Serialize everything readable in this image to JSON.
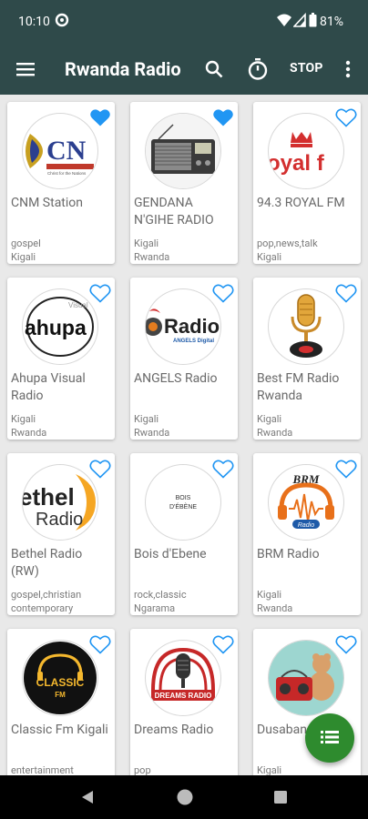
{
  "status_bar": {
    "time": "10:10",
    "battery": "81%"
  },
  "app_bar": {
    "title": "Rwanda Radio",
    "stop_label": "STOP",
    "icons": [
      "menu-icon",
      "search-icon",
      "timer-icon",
      "more-vert-icon"
    ]
  },
  "stations": [
    {
      "name": "CNM Station",
      "genre": "gospel",
      "city": "Kigali",
      "favorite": true,
      "logo_text": "CN",
      "logo_subtext": "Christ for the Nations"
    },
    {
      "name": "GENDANA N'GIHE RADIO",
      "genre": "Kigali",
      "city": "Rwanda",
      "favorite": true,
      "logo_text": "",
      "logo_subtext": ""
    },
    {
      "name": "94.3 ROYAL FM",
      "genre": "pop,news,talk",
      "city": "Kigali",
      "favorite": false,
      "logo_text": "oyal f",
      "logo_subtext": ""
    },
    {
      "name": "Ahupa Visual Radio",
      "genre": "Kigali",
      "city": "Rwanda",
      "favorite": false,
      "logo_text": "ahupa",
      "logo_subtext": "Visual"
    },
    {
      "name": "ANGELS Radio",
      "genre": "Kigali",
      "city": "Rwanda",
      "favorite": false,
      "logo_text": "Radio",
      "logo_subtext": "ANGELS Digital"
    },
    {
      "name": "Best FM Radio Rwanda",
      "genre": "Kigali",
      "city": "Rwanda",
      "favorite": false,
      "logo_text": "",
      "logo_subtext": ""
    },
    {
      "name": "Bethel Radio (RW)",
      "genre": "gospel,christian",
      "city": "contemporary",
      "favorite": false,
      "logo_text": "ethel",
      "logo_subtext": "Radio"
    },
    {
      "name": "Bois d'Ebene",
      "genre": "rock,classic",
      "city": "Ngarama",
      "favorite": false,
      "logo_text": "BOIS",
      "logo_subtext": "D'ÉBÈNE"
    },
    {
      "name": "BRM Radio",
      "genre": "Kigali",
      "city": "Rwanda",
      "favorite": false,
      "logo_text": "BRM",
      "logo_subtext": "Radio"
    },
    {
      "name": "Classic Fm Kigali",
      "genre": "entertainment",
      "city": "",
      "favorite": false,
      "logo_text": "CLASSIC",
      "logo_subtext": "FM"
    },
    {
      "name": "Dreams Radio",
      "genre": "pop",
      "city": "",
      "favorite": false,
      "logo_text": "DREAMS RADIO",
      "logo_subtext": ""
    },
    {
      "name": "Dusabane",
      "genre": "Kigali",
      "city": "",
      "favorite": false,
      "logo_text": "",
      "logo_subtext": ""
    }
  ],
  "colors": {
    "toolbar": "#2f4a4a",
    "heart": "#2196f3",
    "fab": "#2e8b2e"
  }
}
